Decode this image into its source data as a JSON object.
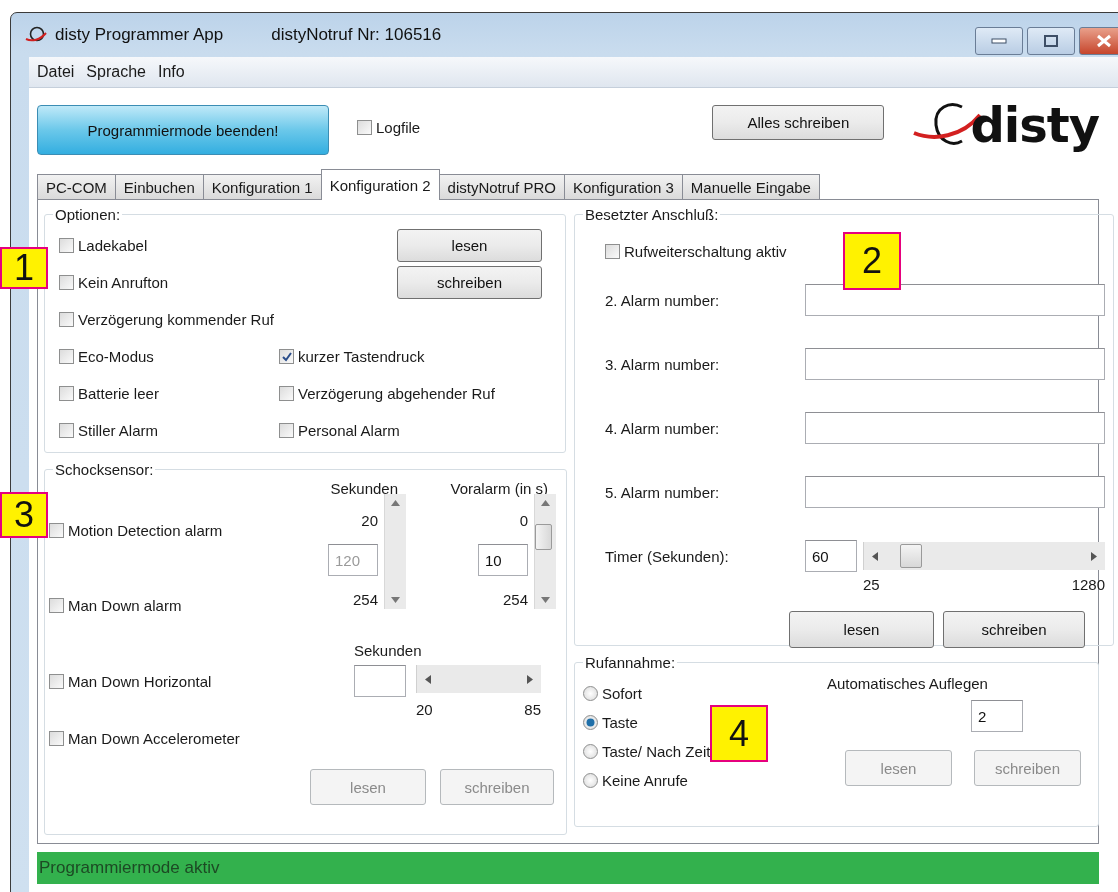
{
  "window": {
    "title": "disty Programmer App",
    "device": "distyNotruf Nr: 106516"
  },
  "menu": [
    "Datei",
    "Sprache",
    "Info"
  ],
  "toolbar": {
    "primary_button": "Programmiermode beenden!",
    "logfile": {
      "label": "Logfile",
      "checked": false
    },
    "write_all_button": "Alles schreiben",
    "logo": "disty"
  },
  "tabs": [
    {
      "label": "PC-COM",
      "selected": false
    },
    {
      "label": "Einbuchen",
      "selected": false
    },
    {
      "label": "Konfiguration 1",
      "selected": false
    },
    {
      "label": "Konfiguration 2",
      "selected": true
    },
    {
      "label": "distyNotruf PRO",
      "selected": false
    },
    {
      "label": "Konfiguration 3",
      "selected": false
    },
    {
      "label": "Manuelle Eingabe",
      "selected": false
    }
  ],
  "options": {
    "title": "Optionen:",
    "checkboxes": [
      {
        "label": "Ladekabel",
        "checked": false
      },
      {
        "label": "Kein Anrufton",
        "checked": false
      },
      {
        "label": "Verzögerung kommender Ruf",
        "checked": false
      },
      {
        "label": "Eco-Modus",
        "checked": false
      },
      {
        "label": "Batterie leer",
        "checked": false
      },
      {
        "label": "Stiller Alarm",
        "checked": false
      }
    ],
    "right_checkboxes": [
      {
        "label": "kurzer Tastendruck",
        "checked": true
      },
      {
        "label": "Verzögerung abgehender Ruf",
        "checked": false
      },
      {
        "label": "Personal Alarm",
        "checked": false
      }
    ],
    "buttons": [
      {
        "label": "lesen",
        "disabled": false
      },
      {
        "label": "schreiben",
        "disabled": false
      }
    ]
  },
  "shock_sensor": {
    "title": "Schocksensor:",
    "checkboxes": [
      {
        "label": "Motion Detection alarm",
        "checked": false
      },
      {
        "label": "Man Down alarm",
        "checked": false
      },
      {
        "label": "Man Down Horizontal",
        "checked": false
      },
      {
        "label": "Man Down Accelerometer",
        "checked": false
      }
    ],
    "spinners": [
      {
        "label": "Sekunden",
        "min": "20",
        "value": "120",
        "max": "254",
        "disabled": true
      },
      {
        "label": "Voralarm (in s)",
        "min": "0",
        "value": "10",
        "max": "254",
        "disabled": false
      }
    ],
    "horizontal": {
      "label": "Sekunden",
      "min": "20",
      "max": "85"
    },
    "buttons": [
      {
        "label": "lesen",
        "disabled": true
      },
      {
        "label": "schreiben",
        "disabled": true
      }
    ]
  },
  "busy_line": {
    "title": "Besetzter Anschluß:",
    "forwarding": {
      "label": "Rufweiterschaltung aktiv",
      "checked": false
    },
    "alarm_numbers": [
      {
        "label": "2. Alarm number:"
      },
      {
        "label": "3. Alarm number:"
      },
      {
        "label": "4. Alarm number:"
      },
      {
        "label": "5. Alarm number:"
      }
    ],
    "timer": {
      "label": "Timer (Sekunden):",
      "value": "60",
      "min": "25",
      "max": "1280"
    },
    "buttons": [
      {
        "label": "lesen",
        "disabled": false
      },
      {
        "label": "schreiben",
        "disabled": false
      }
    ]
  },
  "call_answer": {
    "title": "Rufannahme:",
    "radios": [
      {
        "label": "Sofort",
        "selected": false
      },
      {
        "label": "Taste",
        "selected": true
      },
      {
        "label": "Taste/ Nach Zeit",
        "selected": false
      },
      {
        "label": "Keine Anrufe",
        "selected": false
      }
    ],
    "auto_hangup": {
      "label": "Automatisches Auflegen",
      "value": "2"
    },
    "buttons": [
      {
        "label": "lesen",
        "disabled": true
      },
      {
        "label": "schreiben",
        "disabled": true
      }
    ]
  },
  "status_bar": "Programmiermode aktiv",
  "callouts": [
    "1",
    "2",
    "3",
    "4"
  ]
}
